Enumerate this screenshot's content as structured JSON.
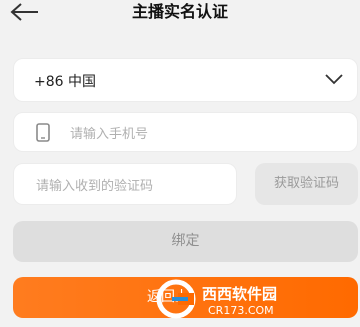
{
  "header": {
    "title": "主播实名认证",
    "back_icon": "back-arrow-icon"
  },
  "form": {
    "country": {
      "value": "+86 中国",
      "icon": "chevron-down-icon"
    },
    "phone": {
      "placeholder": "请输入手机号",
      "icon": "phone-icon"
    },
    "code": {
      "placeholder": "请输入收到的验证码"
    },
    "get_code_label": "获取验证码",
    "bind_label": "绑定",
    "return_label": "返回上"
  },
  "watermark": {
    "brand": "西西软件园",
    "url": "CR173.COM"
  },
  "colors": {
    "background": "#f2f2f2",
    "accent": "#ff6a00",
    "disabled_button": "#dedede"
  }
}
